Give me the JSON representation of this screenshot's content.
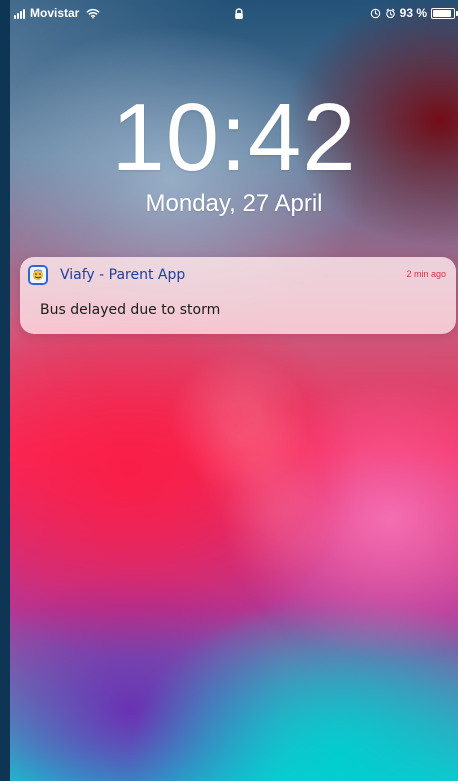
{
  "status_bar": {
    "carrier": "Movistar",
    "battery_percent": "93 %",
    "battery_level": 0.93,
    "icons": [
      "signal-icon",
      "wifi-icon",
      "lock-icon",
      "orientation-lock-icon",
      "alarm-icon",
      "battery-icon"
    ]
  },
  "lock_screen": {
    "time": "10:42",
    "date": "Monday, 27 April"
  },
  "notification": {
    "app_name": "Viafy - Parent App",
    "timestamp": "2 min ago",
    "message": "Bus delayed due to storm",
    "icon": "viafy-app-icon"
  },
  "colors": {
    "notification_title": "#203ea0",
    "timestamp": "#d9334a",
    "text": "#1c1c1c",
    "white": "#ffffff"
  }
}
